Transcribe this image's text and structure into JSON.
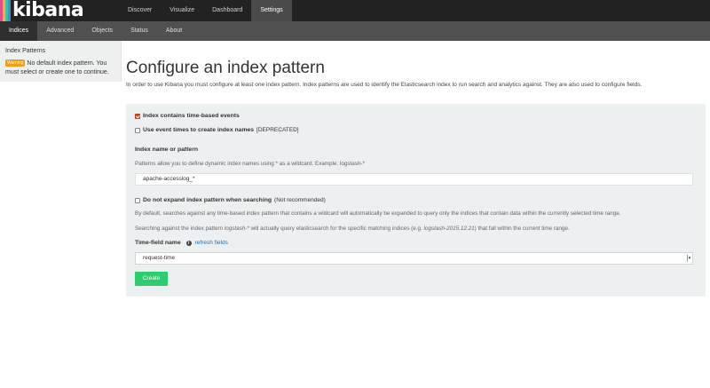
{
  "brand": {
    "name": "kibana",
    "stripe_colors": [
      "#e8478b",
      "#f9b624",
      "#3ebeb0",
      "#3f8fd1"
    ]
  },
  "topnav": {
    "items": [
      {
        "label": "Discover",
        "active": false
      },
      {
        "label": "Visualize",
        "active": false
      },
      {
        "label": "Dashboard",
        "active": false
      },
      {
        "label": "Settings",
        "active": true
      }
    ]
  },
  "subnav": {
    "items": [
      {
        "label": "Indices",
        "active": true
      },
      {
        "label": "Advanced",
        "active": false
      },
      {
        "label": "Objects",
        "active": false
      },
      {
        "label": "Status",
        "active": false
      },
      {
        "label": "About",
        "active": false
      }
    ]
  },
  "sidebar": {
    "title": "Index Patterns",
    "warning_badge": "Warning",
    "warning_text": "No default index pattern. You must select or create one to continue."
  },
  "main": {
    "title": "Configure an index pattern",
    "intro": "In order to use Kibana you must configure at least one index pattern. Index patterns are used to identify the Elasticsearch index to run search and analytics against. They are also used to configure fields."
  },
  "form": {
    "time_based": {
      "label": "Index contains time-based events",
      "checked": true
    },
    "event_times": {
      "label": "Use event times to create index names",
      "suffix": "[DEPRECATED]",
      "checked": false
    },
    "index_name": {
      "label": "Index name or pattern",
      "help": "Patterns allow you to define dynamic index names using * as a wildcard. Example: logstash-*",
      "value": "apache-accesslog_*"
    },
    "no_expand": {
      "label": "Do not expand index pattern when searching",
      "suffix": "(Not recommended)",
      "checked": false
    },
    "expand_help": "By default, searches against any time-based index pattern that contains a wildcard will automatically be expanded to query only the indices that contain data within the currently selected time range.",
    "search_help": {
      "part1": "Searching against the index pattern",
      "pattern": "logstash-*",
      "part2": "will actually query elasticsearch for the specific matching indices (e.g.",
      "example": "logstash-2015.12.21",
      "part3": ") that fall within the current time range."
    },
    "time_field": {
      "label": "Time-field name",
      "refresh_label": "refresh fields",
      "selected": "request-time"
    },
    "create_label": "Create"
  }
}
